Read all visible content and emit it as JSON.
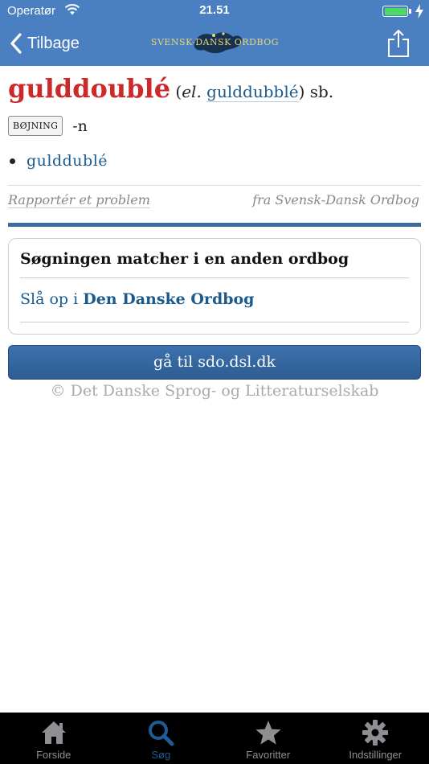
{
  "status_bar": {
    "carrier": "Operatør",
    "time": "21.51"
  },
  "nav": {
    "back_label": "Tilbage",
    "logo_text": "SVENSK-DANSK ORDBOG"
  },
  "entry": {
    "headword": "gulddoublé",
    "paren_open": " (",
    "alt_prefix": "el.",
    "alt_word": "gulddubblé",
    "paren_close": ") sb.",
    "bojning_label": "BØJNING",
    "bojning_form": "-n",
    "variants": [
      "gulddublé"
    ]
  },
  "footer": {
    "report_label": "Rapportér et problem",
    "source_label": "fra Svensk-Dansk Ordbog"
  },
  "panel": {
    "title": "Søgningen matcher i en anden ordbog",
    "link_prefix": "Slå op i ",
    "link_name": "Den Danske Ordbog"
  },
  "goto_button": "gå til sdo.dsl.dk",
  "copyright": "© Det Danske Sprog- og Litteraturselskab",
  "tabs": [
    {
      "label": "Forside",
      "icon": "house-icon",
      "active": false
    },
    {
      "label": "Søg",
      "icon": "search-icon",
      "active": true
    },
    {
      "label": "Favoritter",
      "icon": "star-icon",
      "active": false
    },
    {
      "label": "Indstillinger",
      "icon": "gear-icon",
      "active": false
    }
  ],
  "colors": {
    "header": "#4a7fc1",
    "headword": "#cc2a2a",
    "link": "#1a5a8c",
    "accent_rule": "#3d6b9e",
    "tab_active": "#1d5c96",
    "tab_inactive": "#8e8e93"
  }
}
